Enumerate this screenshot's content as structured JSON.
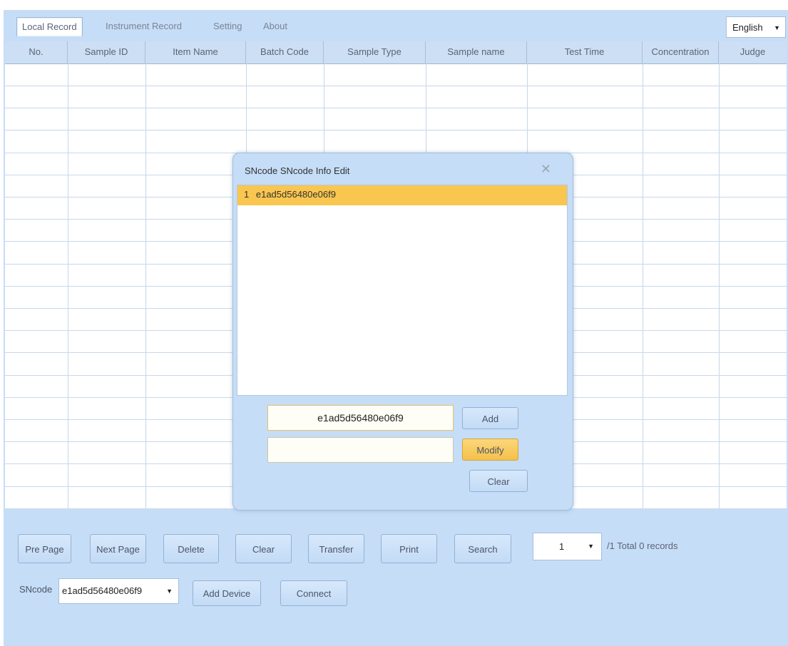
{
  "tabs": [
    {
      "label": "Local Record",
      "active": true
    },
    {
      "label": "Instrument Record",
      "active": false
    },
    {
      "label": "Setting",
      "active": false
    },
    {
      "label": "About",
      "active": false
    }
  ],
  "language": {
    "value": "English"
  },
  "table": {
    "columns": [
      "No.",
      "Sample ID",
      "Item Name",
      "Batch Code",
      "Sample Type",
      "Sample name",
      "Test Time",
      "Concentration",
      "Judge"
    ],
    "rows": []
  },
  "dialog": {
    "title": "SNcode SNcode Info Edit",
    "items": [
      {
        "index": "1",
        "value": "e1ad5d56480e06f9"
      }
    ],
    "input_top_value": "e1ad5d56480e06f9",
    "input_bottom_value": "",
    "add_label": "Add",
    "modify_label": "Modify",
    "clear_label": "Clear"
  },
  "bottom": {
    "buttons": [
      "Pre Page",
      "Next Page",
      "Delete",
      "Clear",
      "Transfer",
      "Print",
      "Search"
    ],
    "page_select_value": "1",
    "page_info": "/1 Total 0 records",
    "sncode_label": "SNcode",
    "sncode_value": "e1ad5d56480e06f9",
    "add_device_label": "Add Device",
    "connect_label": "Connect"
  },
  "colors": {
    "background": "#c6ddf7",
    "selected_row": "#f9c64f",
    "highlight_button": "#f5c04b"
  }
}
